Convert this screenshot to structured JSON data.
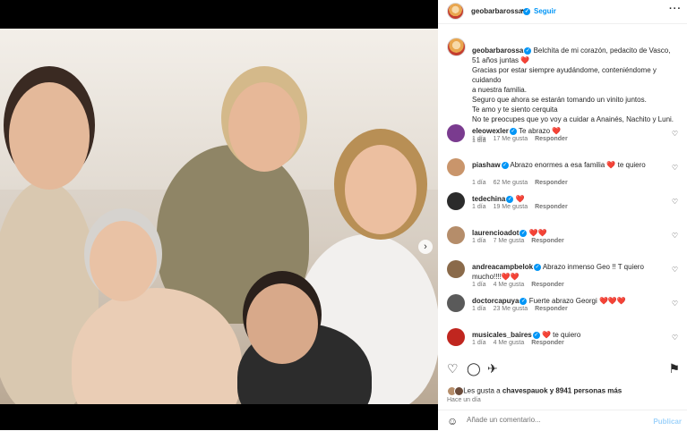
{
  "header": {
    "username": "geobarbarossa",
    "separator": "•",
    "follow_label": "Seguir",
    "more_label": "···"
  },
  "caption": {
    "username": "geobarbarossa",
    "lines": [
      "Belchita de mi corazón, pedacito de Vasco,",
      "51 años juntas ❤️",
      "Gracias por estar siempre ayudándome, conteniéndome y cuidando",
      "a nuestra familia.",
      "Seguro que ahora se estarán tomando un vinito juntos.",
      "Te amo y te siento cerquita",
      "No te preocupes que yo voy a cuidar a Anainés, Nachito y Luni."
    ],
    "time": "1 día"
  },
  "comments": [
    {
      "user": "eleowexler",
      "text": "Te abrazo ❤️",
      "time": "1 día",
      "likes": "17 Me gusta",
      "reply": "Responder",
      "color": "#7a3b8f"
    },
    {
      "user": "piashaw",
      "text": "Abrazo enormes a esa familia ❤️ te quiero",
      "time": "1 día",
      "likes": "62 Me gusta",
      "reply": "Responder",
      "color": "#c9956b"
    },
    {
      "user": "tedechina",
      "text": "❤️",
      "time": "1 día",
      "likes": "19 Me gusta",
      "reply": "Responder",
      "color": "#2b2b2b"
    },
    {
      "user": "laurencioadot",
      "text": "❤️❤️",
      "time": "1 día",
      "likes": "7 Me gusta",
      "reply": "Responder",
      "color": "#b58d6a"
    },
    {
      "user": "andreacampbelok",
      "text": "Abrazo inmenso Geo !! T quiero mucho!!!!❤️❤️",
      "time": "1 día",
      "likes": "4 Me gusta",
      "reply": "Responder",
      "color": "#8a6a4a"
    },
    {
      "user": "doctorcapuya",
      "text": "Fuerte abrazo Georgi ❤️❤️❤️",
      "time": "1 día",
      "likes": "23 Me gusta",
      "reply": "Responder",
      "color": "#5a5a5a"
    },
    {
      "user": "musicales_baires",
      "text": "❤️ te quiero",
      "time": "1 día",
      "likes": "4 Me gusta",
      "reply": "Responder",
      "color": "#c0261f"
    }
  ],
  "likes": {
    "text_prefix": "Les gusta a ",
    "first_user": "chavespauok",
    "text_suffix": " y 8941 personas más"
  },
  "posted": "Hace un día",
  "add_comment": {
    "placeholder": "Añade un comentario...",
    "publish_label": "Publicar"
  },
  "colors": {
    "accent": "#0095f6",
    "heart": "#ed4956"
  }
}
